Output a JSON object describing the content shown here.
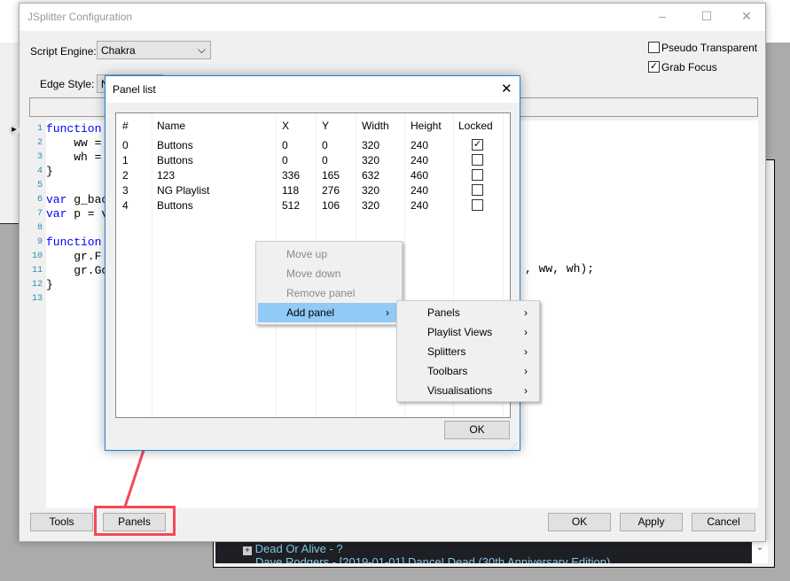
{
  "background_window": {
    "tree_items": [
      "Dead Or Alive - ?",
      "Dave Rodgers - [2019-01-01] Dance! Dead (30th Anniversary Edition)"
    ]
  },
  "window": {
    "title": "JSplitter Configuration",
    "script_engine": {
      "label": "Script Engine:",
      "value": "Chakra"
    },
    "edge_style": {
      "label": "Edge Style:",
      "value": "N"
    },
    "pseudo_transparent": {
      "label": "Pseudo Transparent",
      "checked": false
    },
    "grab_focus": {
      "label": "Grab Focus",
      "checked": true
    },
    "code_lines": [
      {
        "n": "1",
        "kw": "function",
        "rest": ""
      },
      {
        "n": "2",
        "kw": "",
        "rest": "    ww ="
      },
      {
        "n": "3",
        "kw": "",
        "rest": "    wh ="
      },
      {
        "n": "4",
        "kw": "",
        "rest": "}"
      },
      {
        "n": "5",
        "kw": "",
        "rest": ""
      },
      {
        "n": "6",
        "kw": "var",
        "rest": " g_bac"
      },
      {
        "n": "7",
        "kw": "var",
        "rest": " p = v"
      },
      {
        "n": "8",
        "kw": "",
        "rest": ""
      },
      {
        "n": "9",
        "kw": "function",
        "rest": ""
      },
      {
        "n": "10",
        "kw": "",
        "rest": "    gr.F"
      },
      {
        "n": "11",
        "kw": "",
        "rest": "    gr.Go"
      },
      {
        "n": "12",
        "kw": "",
        "rest": "}"
      },
      {
        "n": "13",
        "kw": "",
        "rest": ""
      }
    ],
    "code_tail": ", ww, wh);",
    "buttons": {
      "tools": "Tools",
      "panels": "Panels",
      "ok": "OK",
      "apply": "Apply",
      "cancel": "Cancel"
    }
  },
  "panel_list": {
    "title": "Panel list",
    "ok": "OK",
    "columns": [
      "#",
      "Name",
      "X",
      "Y",
      "Width",
      "Height",
      "Locked"
    ],
    "rows": [
      {
        "i": "0",
        "name": "Buttons",
        "x": "0",
        "y": "0",
        "w": "320",
        "h": "240",
        "locked": true
      },
      {
        "i": "1",
        "name": "Buttons",
        "x": "0",
        "y": "0",
        "w": "320",
        "h": "240",
        "locked": false
      },
      {
        "i": "2",
        "name": "123",
        "x": "336",
        "y": "165",
        "w": "632",
        "h": "460",
        "locked": false
      },
      {
        "i": "3",
        "name": "NG Playlist",
        "x": "118",
        "y": "276",
        "w": "320",
        "h": "240",
        "locked": false
      },
      {
        "i": "4",
        "name": "Buttons",
        "x": "512",
        "y": "106",
        "w": "320",
        "h": "240",
        "locked": false
      }
    ]
  },
  "context_menu": {
    "items": [
      {
        "label": "Move up",
        "disabled": true
      },
      {
        "label": "Move down",
        "disabled": true
      },
      {
        "label": "Remove panel",
        "disabled": true
      },
      {
        "label": "Add panel",
        "highlighted": true,
        "submenu": true
      }
    ]
  },
  "submenu": {
    "items": [
      "Panels",
      "Playlist Views",
      "Splitters",
      "Toolbars",
      "Visualisations"
    ]
  },
  "colors": {
    "highlight": "#91c9f7",
    "annotation": "#f24a5a",
    "dialog_border": "#1883d7",
    "keyword": "#0000ff"
  }
}
